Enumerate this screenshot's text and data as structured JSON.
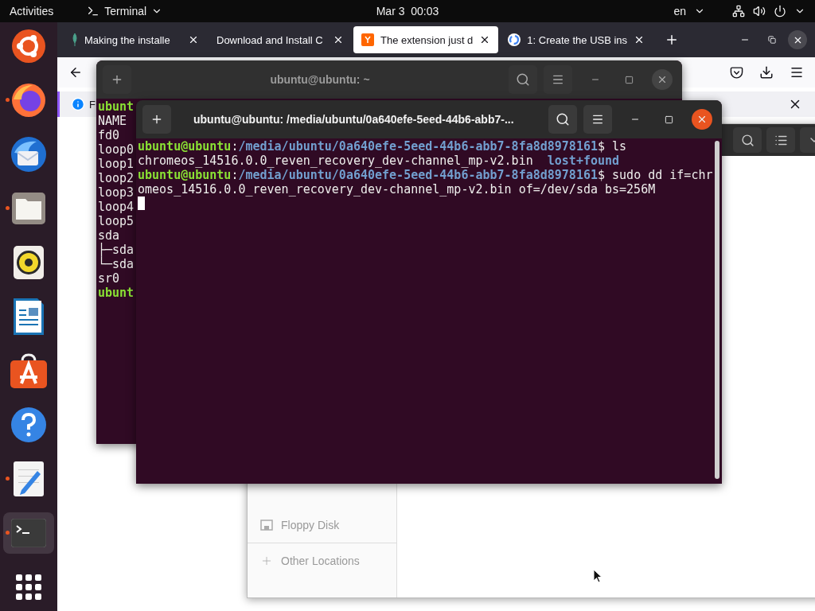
{
  "top_bar": {
    "activities": "Activities",
    "app_menu": "Terminal",
    "clock": "Mar 3  00:03",
    "language": "en"
  },
  "dock": {
    "items": [
      {
        "kind": "ubuntu",
        "running": false,
        "selected": false
      },
      {
        "kind": "firefox",
        "running": true,
        "selected": false
      },
      {
        "kind": "mail",
        "running": false,
        "selected": false
      },
      {
        "kind": "files",
        "running": true,
        "selected": false
      },
      {
        "kind": "music",
        "running": false,
        "selected": false
      },
      {
        "kind": "writer",
        "running": false,
        "selected": false
      },
      {
        "kind": "store",
        "running": false,
        "selected": false
      },
      {
        "kind": "help",
        "running": false,
        "selected": false
      },
      {
        "kind": "editor",
        "running": true,
        "selected": false
      },
      {
        "kind": "terminal",
        "running": true,
        "selected": true
      },
      {
        "kind": "grid",
        "running": false,
        "selected": false
      }
    ]
  },
  "browser": {
    "tabs": [
      {
        "label": "Making the installe",
        "kind": "leaf",
        "selected": false
      },
      {
        "label": "Download and Install C",
        "kind": "plain",
        "selected": false
      },
      {
        "label": "The extension just d",
        "kind": "square",
        "selected": true
      },
      {
        "label": "1: Create the USB ins",
        "kind": "google",
        "selected": false
      }
    ],
    "notification": {
      "text": "F"
    }
  },
  "file_manager": {
    "sidebar": [
      {
        "label": "Floppy Disk",
        "kind": "drive"
      },
      {
        "label": "Other Locations",
        "kind": "plus"
      }
    ]
  },
  "terminals": [
    {
      "title": "ubuntu@ubuntu: ~",
      "focused": false,
      "cursor": false,
      "lines": [
        [
          {
            "kind": "user",
            "text": "ubunt"
          }
        ],
        [
          {
            "kind": "text",
            "text": "NAME"
          }
        ],
        [
          {
            "kind": "text",
            "text": "fd0"
          }
        ],
        [
          {
            "kind": "text",
            "text": "loop0"
          }
        ],
        [
          {
            "kind": "text",
            "text": "loop1"
          }
        ],
        [
          {
            "kind": "text",
            "text": "loop2"
          }
        ],
        [
          {
            "kind": "text",
            "text": "loop3"
          }
        ],
        [
          {
            "kind": "text",
            "text": "loop4"
          }
        ],
        [
          {
            "kind": "text",
            "text": "loop5"
          }
        ],
        [
          {
            "kind": "text",
            "text": "sda"
          }
        ],
        [
          {
            "kind": "text",
            "text": "├─sda"
          }
        ],
        [
          {
            "kind": "text",
            "text": "└─sda"
          }
        ],
        [
          {
            "kind": "text",
            "text": "sr0"
          }
        ],
        [
          {
            "kind": "user",
            "text": "ubunt"
          }
        ]
      ]
    },
    {
      "title": "ubuntu@ubuntu: /media/ubuntu/0a640efe-5eed-44b6-abb7-...",
      "focused": true,
      "cursor": true,
      "lines": [
        [
          {
            "kind": "user",
            "text": "ubuntu@ubuntu"
          },
          {
            "kind": "text",
            "text": ":"
          },
          {
            "kind": "path",
            "text": "/media/ubuntu/0a640efe-5eed-44b6-abb7-8fa8d8978161"
          },
          {
            "kind": "text",
            "text": "$ ls"
          }
        ],
        [
          {
            "kind": "text",
            "text": "chromeos_14516.0.0_reven_recovery_dev-channel_mp-v2.bin  "
          },
          {
            "kind": "dir",
            "text": "lost+found"
          }
        ],
        [
          {
            "kind": "user",
            "text": "ubuntu@ubuntu"
          },
          {
            "kind": "text",
            "text": ":"
          },
          {
            "kind": "path",
            "text": "/media/ubuntu/0a640efe-5eed-44b6-abb7-8fa8d8978161"
          },
          {
            "kind": "text",
            "text": "$ sudo dd if=chr"
          }
        ],
        [
          {
            "kind": "text",
            "text": "omeos_14516.0.0_reven_recovery_dev-channel_mp-v2.bin of=/dev/sda bs=256M"
          }
        ]
      ]
    }
  ]
}
